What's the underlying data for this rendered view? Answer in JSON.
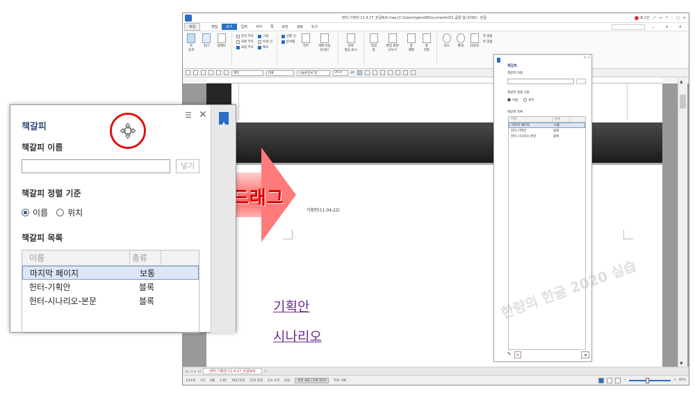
{
  "app": {
    "title": "헌터-기획안-11.4.27_한글토트.hwp [C:\\Users\\rgbnoWDocuments\\01 글꼴 입니다W] - 한글",
    "login": "로그인",
    "menu": [
      "파일",
      "편집",
      "보기",
      "입력",
      "서식",
      "쪽",
      "보안",
      "검토",
      "도구"
    ],
    "active_menu": "보기"
  },
  "ribbon": {
    "groups": [
      {
        "label": "쪽\n윤곽",
        "icon": "page-outline-icon"
      },
      {
        "label": "접기",
        "icon": "fold-icon"
      },
      {
        "label": "원메모",
        "icon": "memo-icon"
      }
    ],
    "checks_col1": [
      {
        "label": "문단 부호",
        "on": false
      },
      {
        "label": "조판 부호",
        "on": false
      },
      {
        "label": "교정 부호",
        "on": true
      }
    ],
    "checks_col2": [
      {
        "label": "그림",
        "on": true
      },
      {
        "label": "투명 선",
        "on": false
      },
      {
        "label": "메모",
        "on": true
      }
    ],
    "checks_col3": [
      {
        "label": "상황 선",
        "on": true
      },
      {
        "label": "문서탭",
        "on": true
      }
    ],
    "buttons": [
      {
        "label": "격자"
      },
      {
        "label": "개체 이동\n안내선"
      },
      {
        "label": "현자\n발음 표시"
      },
      {
        "label": "작업\n창"
      },
      {
        "label": "편집 화면\n나누기"
      },
      {
        "label": "창\n배열"
      },
      {
        "label": "창\n전환"
      },
      {
        "label": "축소"
      },
      {
        "label": "확대"
      },
      {
        "label": "100%"
      }
    ],
    "page_labels": [
      "쪽 맞춤",
      "쪽 맞춤"
    ]
  },
  "formatbar": {
    "style": "제목",
    "lang": "대표",
    "font": "나눔손글씨 달",
    "size": "25.0",
    "unit": "pt"
  },
  "document": {
    "text1": "기획안(11.04.22)",
    "link1": "기획안",
    "link2": "시나리오",
    "tab": "헌터-기획안-11.4.27_한글토트"
  },
  "statusbar": {
    "items": [
      "1/11쪽",
      "1단",
      "6줄",
      "13칸",
      "7817글자",
      "문자 입력",
      "2/4 구역",
      "삽입",
      "변경 내용 [기록 중지]",
      "Tt수: 0N"
    ],
    "zoom": "85%"
  },
  "small_panel": {
    "title": "책갈피",
    "name_label": "책갈피 이름",
    "sort_label": "책갈피 정렬 기준",
    "radio1": "이름",
    "radio2": "위치",
    "list_label": "책갈피 목록",
    "col1": "이름",
    "col2": "종류",
    "rows": [
      {
        "name": "마지막 페이지",
        "type": "보통"
      },
      {
        "name": "헌터-기획안",
        "type": "블록"
      },
      {
        "name": "헌터-시나리오-본문",
        "type": "블록"
      }
    ]
  },
  "zoom_panel": {
    "title": "책갈피",
    "name_label": "책갈피 이름",
    "insert_button": "넣기",
    "sort_label": "책갈피 정렬 기준",
    "radio1": "이름",
    "radio2": "위치",
    "list_label": "책갈피 목록",
    "col1": "이름",
    "col2": "종류",
    "rows": [
      {
        "name": "마지막 페이지",
        "type": "보통"
      },
      {
        "name": "헌터-기획안",
        "type": "블록"
      },
      {
        "name": "헌터-시나리오-본문",
        "type": "블록"
      }
    ]
  },
  "overlay": {
    "drag_label": "드래그",
    "watermark": "한량의 한글 2020 실습"
  },
  "colors": {
    "accent": "#2b6cc4",
    "drag_text": "#d60000",
    "link": "#6a2a8e",
    "highlight_ring": "#e01010"
  }
}
